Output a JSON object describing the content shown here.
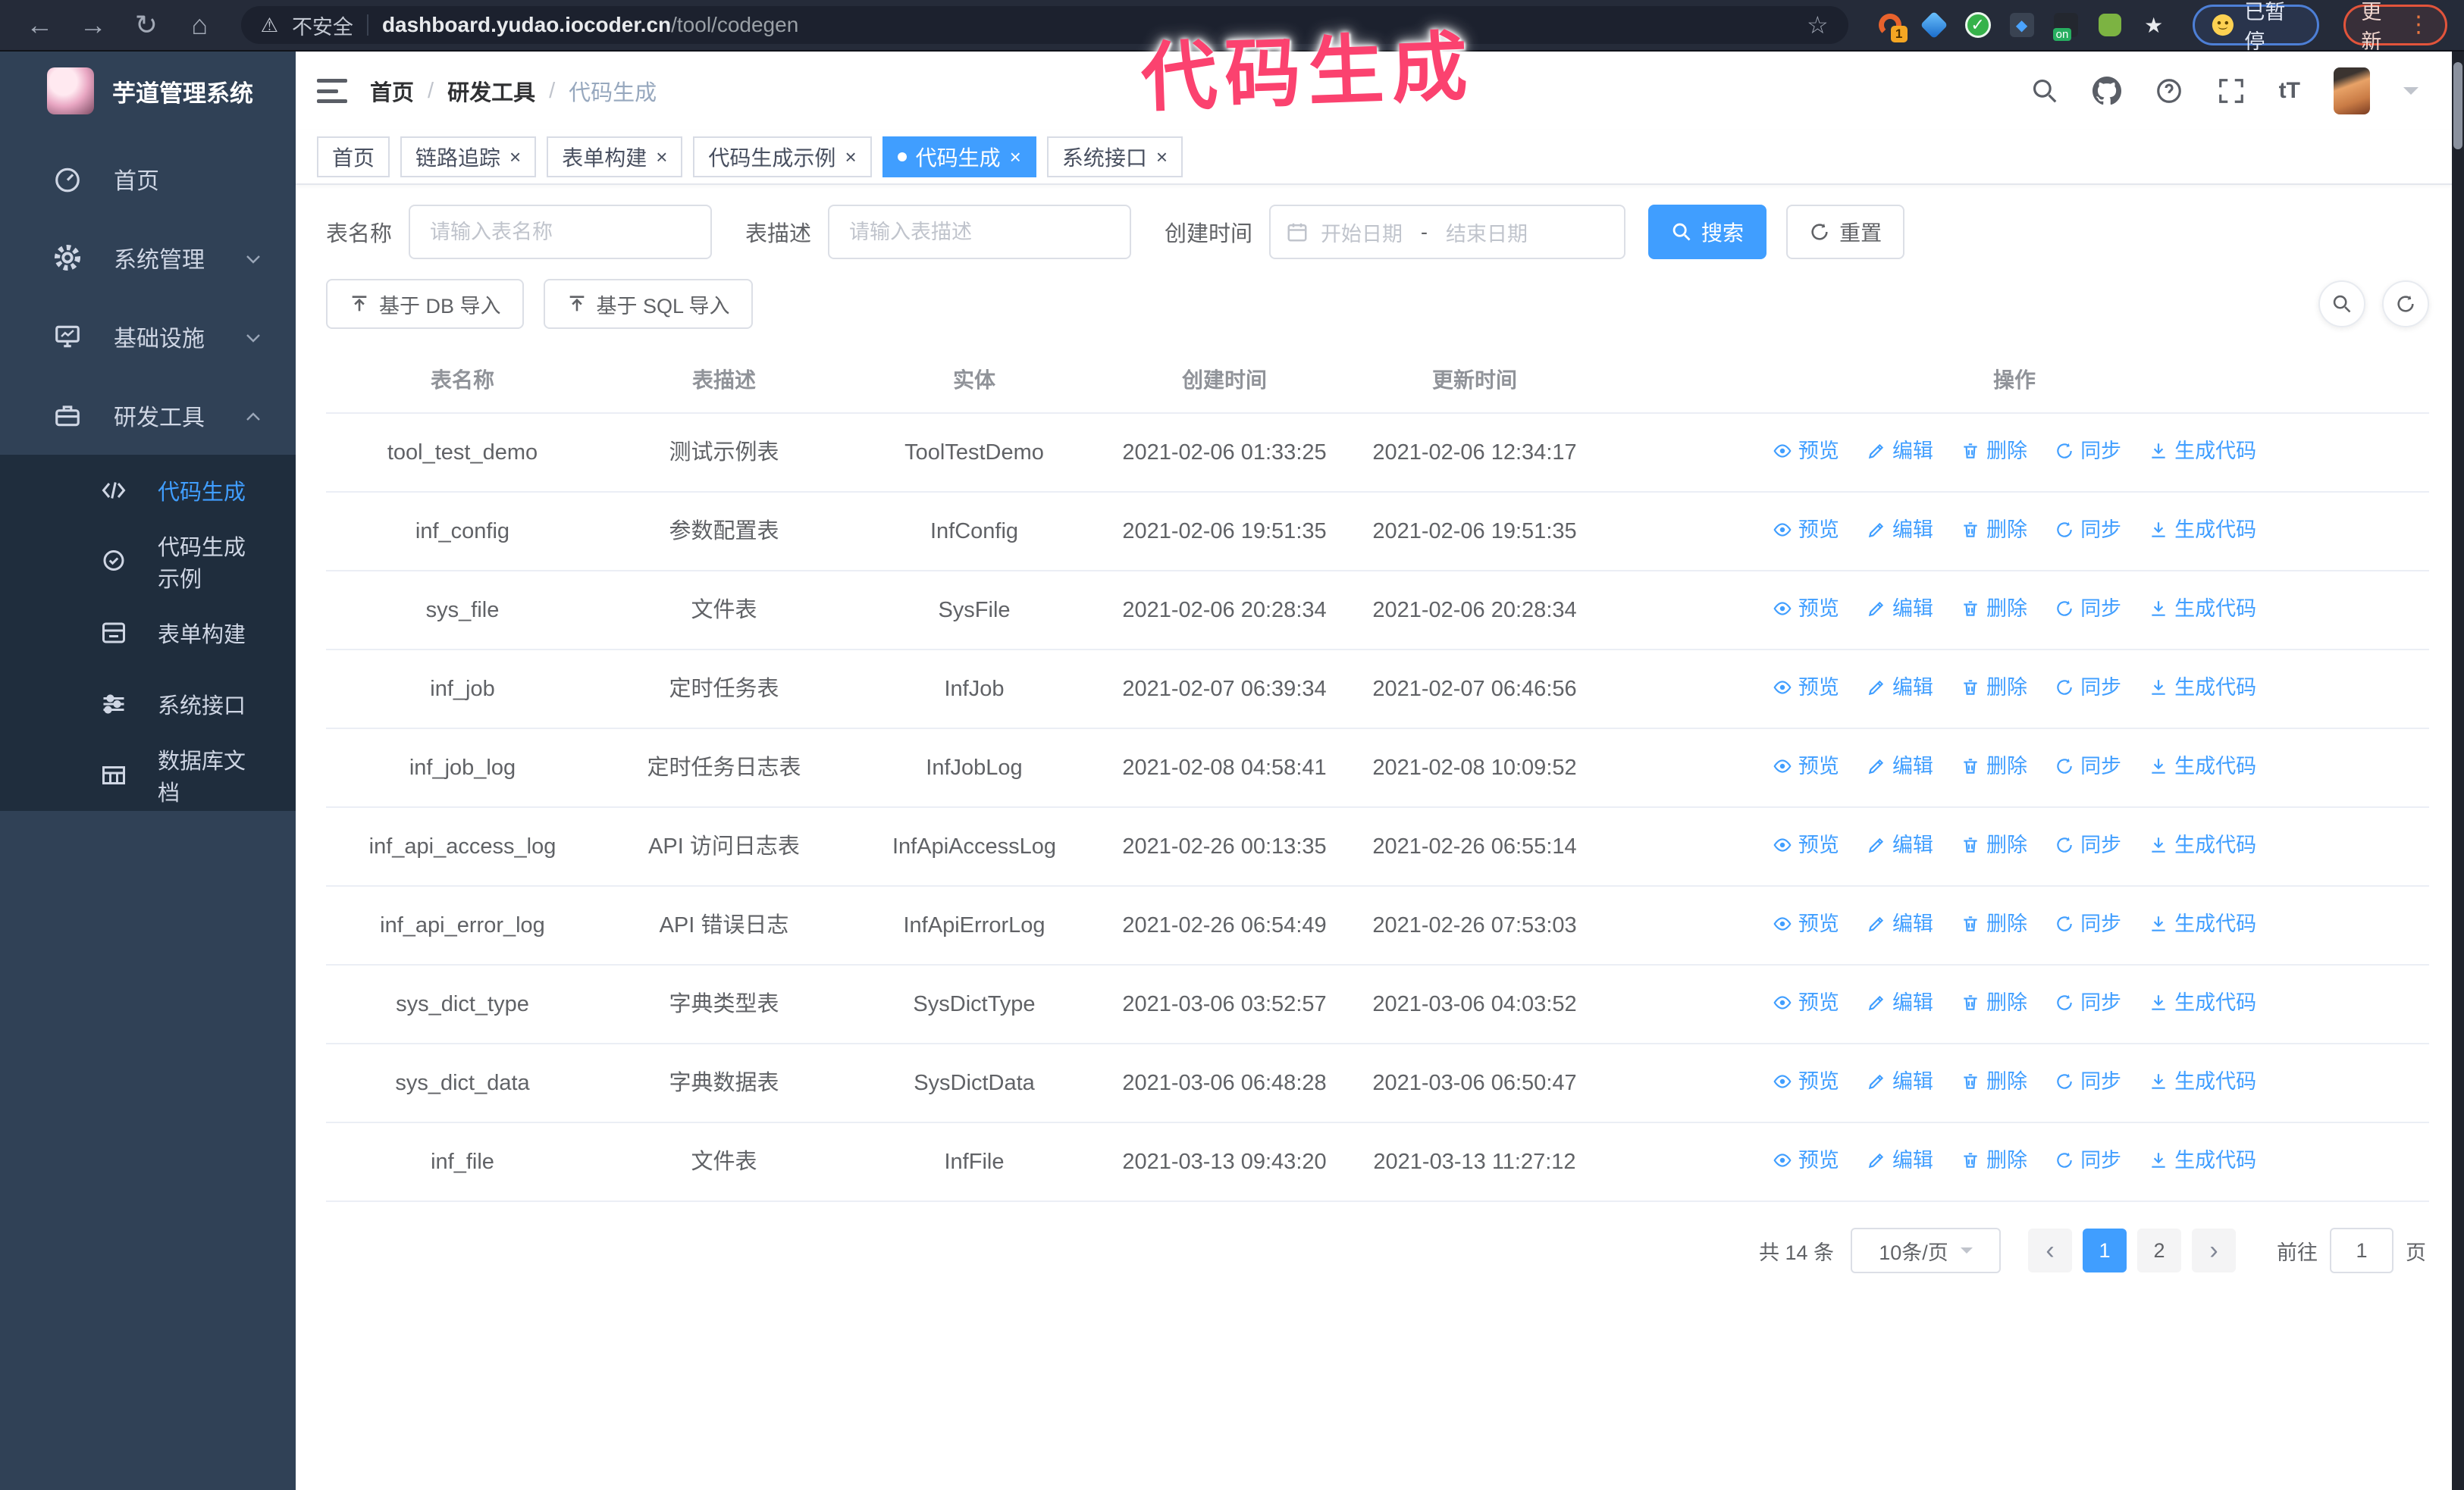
{
  "browser": {
    "security_label": "不安全",
    "url_domain": "dashboard.yudao.iocoder.cn",
    "url_path": "/tool/codegen",
    "paused_badge": "已暂停",
    "update_button": "更新"
  },
  "annotation": {
    "text": "代码生成",
    "color": "#fb426f"
  },
  "sidebar": {
    "app_title": "芋道管理系统",
    "items": [
      {
        "label": "首页"
      },
      {
        "label": "系统管理"
      },
      {
        "label": "基础设施"
      },
      {
        "label": "研发工具"
      }
    ],
    "sub_items": [
      {
        "label": "代码生成",
        "active": true
      },
      {
        "label": "代码生成示例"
      },
      {
        "label": "表单构建"
      },
      {
        "label": "系统接口"
      },
      {
        "label": "数据库文档"
      }
    ]
  },
  "breadcrumb": {
    "items": [
      "首页",
      "研发工具",
      "代码生成"
    ]
  },
  "tabs": [
    {
      "label": "首页"
    },
    {
      "label": "链路追踪"
    },
    {
      "label": "表单构建"
    },
    {
      "label": "代码生成示例"
    },
    {
      "label": "代码生成"
    },
    {
      "label": "系统接口"
    }
  ],
  "filters": {
    "table_name_label": "表名称",
    "table_name_placeholder": "请输入表名称",
    "table_desc_label": "表描述",
    "table_desc_placeholder": "请输入表描述",
    "create_time_label": "创建时间",
    "date_start_placeholder": "开始日期",
    "date_separator": "-",
    "date_end_placeholder": "结束日期",
    "search_button": "搜索",
    "reset_button": "重置"
  },
  "toolbar": {
    "import_db_button": "基于 DB 导入",
    "import_sql_button": "基于 SQL 导入"
  },
  "table": {
    "columns": [
      "表名称",
      "表描述",
      "实体",
      "创建时间",
      "更新时间",
      "操作"
    ],
    "actions": [
      "预览",
      "编辑",
      "删除",
      "同步",
      "生成代码"
    ],
    "rows": [
      {
        "name": "tool_test_demo",
        "desc": "测试示例表",
        "entity": "ToolTestDemo",
        "created": "2021-02-06 01:33:25",
        "updated": "2021-02-06 12:34:17"
      },
      {
        "name": "inf_config",
        "desc": "参数配置表",
        "entity": "InfConfig",
        "created": "2021-02-06 19:51:35",
        "updated": "2021-02-06 19:51:35"
      },
      {
        "name": "sys_file",
        "desc": "文件表",
        "entity": "SysFile",
        "created": "2021-02-06 20:28:34",
        "updated": "2021-02-06 20:28:34"
      },
      {
        "name": "inf_job",
        "desc": "定时任务表",
        "entity": "InfJob",
        "created": "2021-02-07 06:39:34",
        "updated": "2021-02-07 06:46:56"
      },
      {
        "name": "inf_job_log",
        "desc": "定时任务日志表",
        "entity": "InfJobLog",
        "created": "2021-02-08 04:58:41",
        "updated": "2021-02-08 10:09:52"
      },
      {
        "name": "inf_api_access_log",
        "desc": "API 访问日志表",
        "entity": "InfApiAccessLog",
        "created": "2021-02-26 00:13:35",
        "updated": "2021-02-26 06:55:14"
      },
      {
        "name": "inf_api_error_log",
        "desc": "API 错误日志",
        "entity": "InfApiErrorLog",
        "created": "2021-02-26 06:54:49",
        "updated": "2021-02-26 07:53:03"
      },
      {
        "name": "sys_dict_type",
        "desc": "字典类型表",
        "entity": "SysDictType",
        "created": "2021-03-06 03:52:57",
        "updated": "2021-03-06 04:03:52"
      },
      {
        "name": "sys_dict_data",
        "desc": "字典数据表",
        "entity": "SysDictData",
        "created": "2021-03-06 06:48:28",
        "updated": "2021-03-06 06:50:47"
      },
      {
        "name": "inf_file",
        "desc": "文件表",
        "entity": "InfFile",
        "created": "2021-03-13 09:43:20",
        "updated": "2021-03-13 11:27:12"
      }
    ]
  },
  "pagination": {
    "total_text": "共 14 条",
    "page_size": "10条/页",
    "pages": [
      "1",
      "2"
    ],
    "active_page": "1",
    "goto_label": "前往",
    "goto_value": "1",
    "goto_suffix": "页"
  },
  "icons": {
    "back": "←",
    "forward": "→",
    "refresh": "↻",
    "home": "⌂",
    "warning": "⚠",
    "star": "☆",
    "edit": "✎",
    "check": "✓",
    "diamond": "◆",
    "puzzle": "★",
    "vdots": "⋮",
    "ext_badge": "1",
    "ext_on": "on",
    "chevron_left": "‹",
    "chevron_right": "›",
    "tt": "tT"
  },
  "colors": {
    "accent": "#409eff",
    "sidebar_bg": "#304156",
    "submenu_bg": "#1f2d3d",
    "annotation": "#fb426f",
    "chrome_bg": "#252b39",
    "table_border": "#ebeef5"
  }
}
